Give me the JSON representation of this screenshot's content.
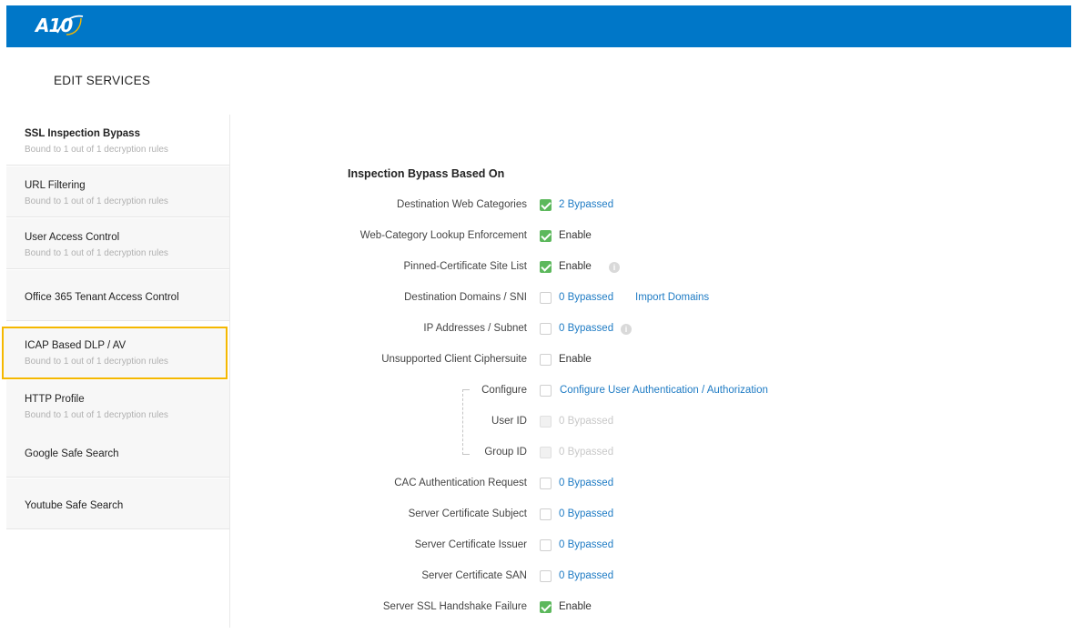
{
  "header": {
    "logo_text": "A10",
    "color": "#0077c8"
  },
  "page_title": "EDIT SERVICES",
  "sidebar": {
    "items": [
      {
        "label": "SSL Inspection Bypass",
        "sub": "Bound to 1 out of 1 decryption rules"
      },
      {
        "label": "URL Filtering",
        "sub": "Bound to 1 out of 1 decryption rules"
      },
      {
        "label": "User Access Control",
        "sub": "Bound to 1 out of 1 decryption rules"
      },
      {
        "label": "Office 365 Tenant Access Control",
        "sub": ""
      },
      {
        "label": "ICAP Based DLP / AV",
        "sub": "Bound to 1 out of 1 decryption rules"
      },
      {
        "label": "HTTP Profile",
        "sub": "Bound to 1 out of 1 decryption rules"
      },
      {
        "label": "Google Safe Search",
        "sub": ""
      },
      {
        "label": "Youtube Safe Search",
        "sub": ""
      }
    ]
  },
  "main": {
    "section_title": "Inspection Bypass Based On",
    "rows": [
      {
        "label": "Destination Web Categories",
        "checked": true,
        "value": "2 Bypassed"
      },
      {
        "label": "Web-Category Lookup Enforcement",
        "checked": true,
        "value": "Enable"
      },
      {
        "label": "Pinned-Certificate Site List",
        "checked": true,
        "value": "Enable",
        "info": "i"
      },
      {
        "label": "Destination Domains / SNI",
        "checked": false,
        "value": "0 Bypassed",
        "extra": "Import Domains"
      },
      {
        "label": "IP Addresses / Subnet",
        "checked": false,
        "value": "0 Bypassed",
        "info": "i"
      },
      {
        "label": "Unsupported Client Ciphersuite",
        "checked": false,
        "value": "Enable"
      },
      {
        "label": "Configure",
        "checked": false,
        "value": "Configure User Authentication / Authorization"
      },
      {
        "label": "User ID",
        "checked": false,
        "value": "0 Bypassed"
      },
      {
        "label": "Group ID",
        "checked": false,
        "value": "0 Bypassed"
      },
      {
        "label": "CAC Authentication Request",
        "checked": false,
        "value": "0 Bypassed"
      },
      {
        "label": "Server Certificate Subject",
        "checked": false,
        "value": "0 Bypassed"
      },
      {
        "label": "Server Certificate Issuer",
        "checked": false,
        "value": "0 Bypassed"
      },
      {
        "label": "Server Certificate SAN",
        "checked": false,
        "value": "0 Bypassed"
      },
      {
        "label": "Server SSL Handshake Failure",
        "checked": true,
        "value": "Enable"
      }
    ]
  },
  "colors": {
    "accent": "#0077c8",
    "link": "#1e7bc4",
    "check": "#5cb85c",
    "highlight": "#f5b800"
  }
}
